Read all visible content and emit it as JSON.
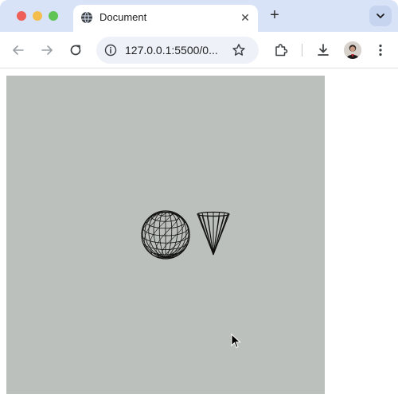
{
  "browser": {
    "tab": {
      "title": "Document",
      "close_glyph": "✕",
      "favicon": "globe-icon"
    },
    "new_tab_glyph": "+",
    "tab_menu_icon": "chevron-down-icon",
    "nav": {
      "back_icon": "arrow-left-icon",
      "forward_icon": "arrow-right-icon",
      "reload_icon": "reload-icon"
    },
    "address": {
      "url": "127.0.0.1:5500/0...",
      "info_icon": "info-icon",
      "bookmark_icon": "star-icon"
    },
    "toolbar_icons": [
      "puzzle-icon",
      "download-icon",
      "avatar",
      "more-vert-icon"
    ]
  },
  "scene": {
    "background": "#bcc0bc",
    "objects": [
      "wireframe-sphere",
      "wireframe-cone"
    ],
    "line_color": "#111111"
  }
}
